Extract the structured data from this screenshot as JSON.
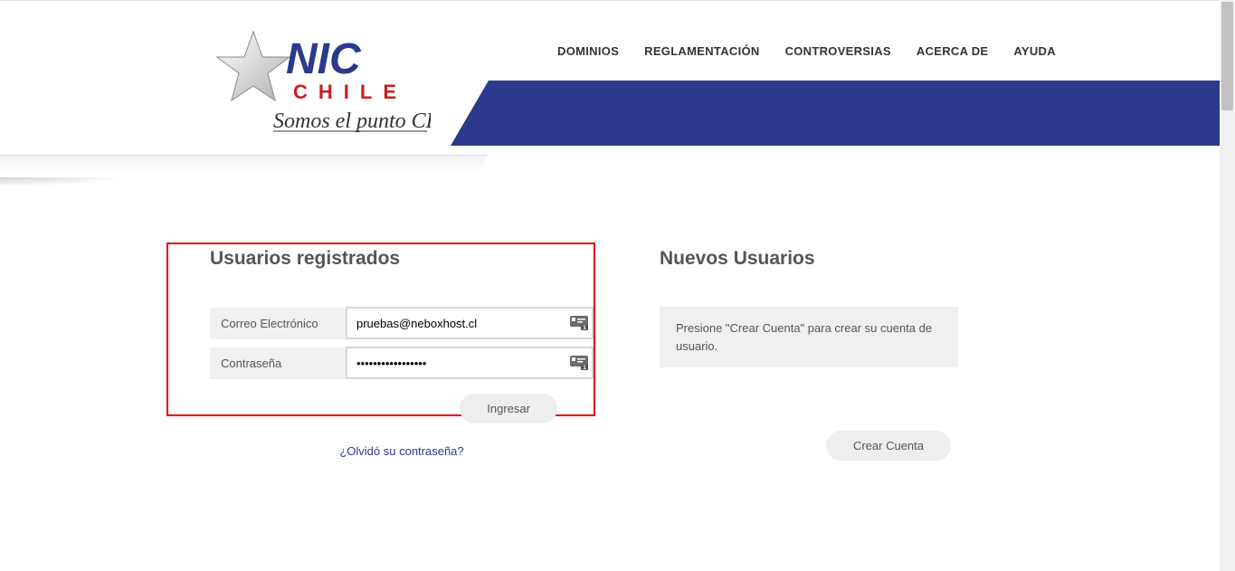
{
  "brand": {
    "name_top": "NIC",
    "name_bottom": "CHILE",
    "tagline": "Somos el punto CL"
  },
  "nav": {
    "items": [
      "DOMINIOS",
      "REGLAMENTACIÓN",
      "CONTROVERSIAS",
      "ACERCA DE",
      "AYUDA"
    ]
  },
  "login": {
    "title": "Usuarios registrados",
    "email_label": "Correo Electrónico",
    "email_value": "pruebas@neboxhost.cl",
    "password_label": "Contraseña",
    "password_value": "•••••••••••••••••",
    "submit_label": "Ingresar",
    "forgot_label": "¿Olvidó su contraseña?"
  },
  "signup": {
    "title": "Nuevos Usuarios",
    "info_text": "Presione \"Crear Cuenta\" para crear su cuenta de usuario.",
    "button_label": "Crear Cuenta"
  },
  "colors": {
    "brand_blue": "#2b3a8c",
    "highlight_red": "#e60000"
  }
}
